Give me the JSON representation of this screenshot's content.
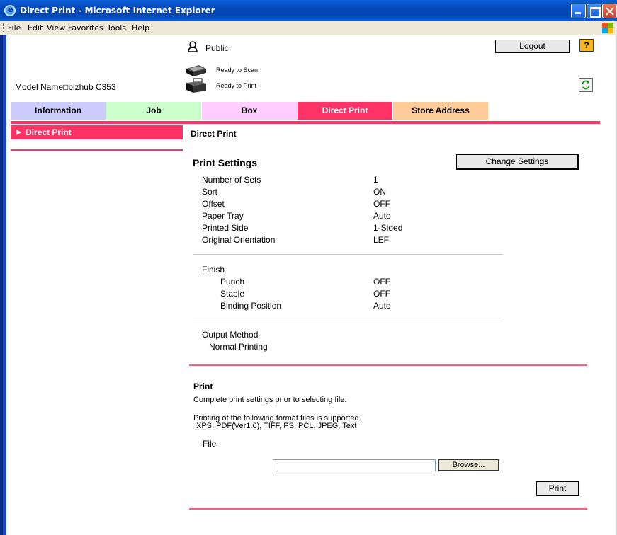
{
  "window": {
    "title": "Direct Print - Microsoft Internet Explorer"
  },
  "menu": [
    "File",
    "Edit",
    "View",
    "Favorites",
    "Tools",
    "Help"
  ],
  "header": {
    "user": "Public",
    "logout_label": "Logout",
    "help_label": "?",
    "status_scan": "Ready to Scan",
    "status_print": "Ready to Print",
    "model_name": "Model Name□bizhub C353"
  },
  "tabs": [
    "Information",
    "Job",
    "Box",
    "Direct Print",
    "Store Address"
  ],
  "active_tab": "Direct Print",
  "sidebar": {
    "items": [
      {
        "label": "Direct Print"
      }
    ]
  },
  "main": {
    "title": "Direct Print",
    "print_settings": {
      "title": "Print Settings",
      "change_label": "Change Settings",
      "rows": [
        {
          "label": "Number of Sets",
          "value": "1"
        },
        {
          "label": "Sort",
          "value": "ON"
        },
        {
          "label": "Offset",
          "value": "OFF"
        },
        {
          "label": "Paper Tray",
          "value": "Auto"
        },
        {
          "label": "Printed Side",
          "value": "1-Sided"
        },
        {
          "label": "Original Orientation",
          "value": "LEF"
        }
      ],
      "finish": {
        "label": "Finish",
        "rows": [
          {
            "label": "Punch",
            "value": "OFF"
          },
          {
            "label": "Staple",
            "value": "OFF"
          },
          {
            "label": "Binding Position",
            "value": "Auto"
          }
        ]
      },
      "output": {
        "label": "Output Method",
        "value": "Normal Printing"
      }
    },
    "print": {
      "title": "Print",
      "note": "Complete print settings prior to selecting file.",
      "support": "Printing of the following format files is supported.",
      "formats": "XPS, PDF(Ver1.6), TIFF, PS, PCL, JPEG, Text",
      "file_label": "File",
      "file_value": "",
      "browse_label": "Browse...",
      "print_label": "Print"
    }
  },
  "colors": {
    "accent": "#ff3366",
    "tab_information": "#ccccff",
    "tab_job": "#ccffcc",
    "tab_box": "#ffccff",
    "tab_store": "#ffcc99"
  }
}
